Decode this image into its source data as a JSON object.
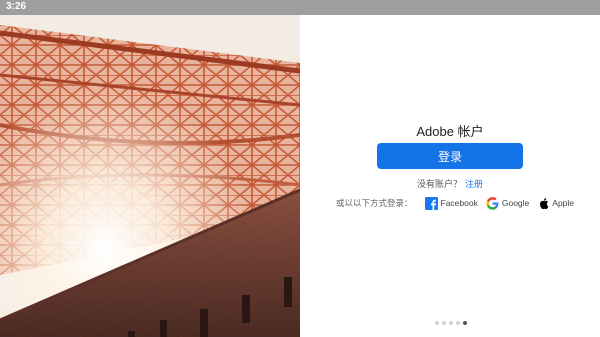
{
  "status_bar": {
    "time": "3:26"
  },
  "account": {
    "title": "Adobe 帐户",
    "signin_label": "登录",
    "no_account_text": "没有账户？",
    "register_label": "注册",
    "social_prompt": "或以以下方式登录：",
    "social": [
      {
        "name": "Facebook",
        "icon": "facebook-icon",
        "color": "#1877f2"
      },
      {
        "name": "Google",
        "icon": "google-icon",
        "color": "#4285f4"
      },
      {
        "name": "Apple",
        "icon": "apple-icon",
        "color": "#000000"
      }
    ]
  },
  "carousel": {
    "page_count": 5,
    "active_index": 4
  },
  "colors": {
    "accent": "#1473e6",
    "status_bar": "#9e9e9e"
  },
  "hero_image": {
    "subject": "bridge-truss-over-brick-fort"
  }
}
